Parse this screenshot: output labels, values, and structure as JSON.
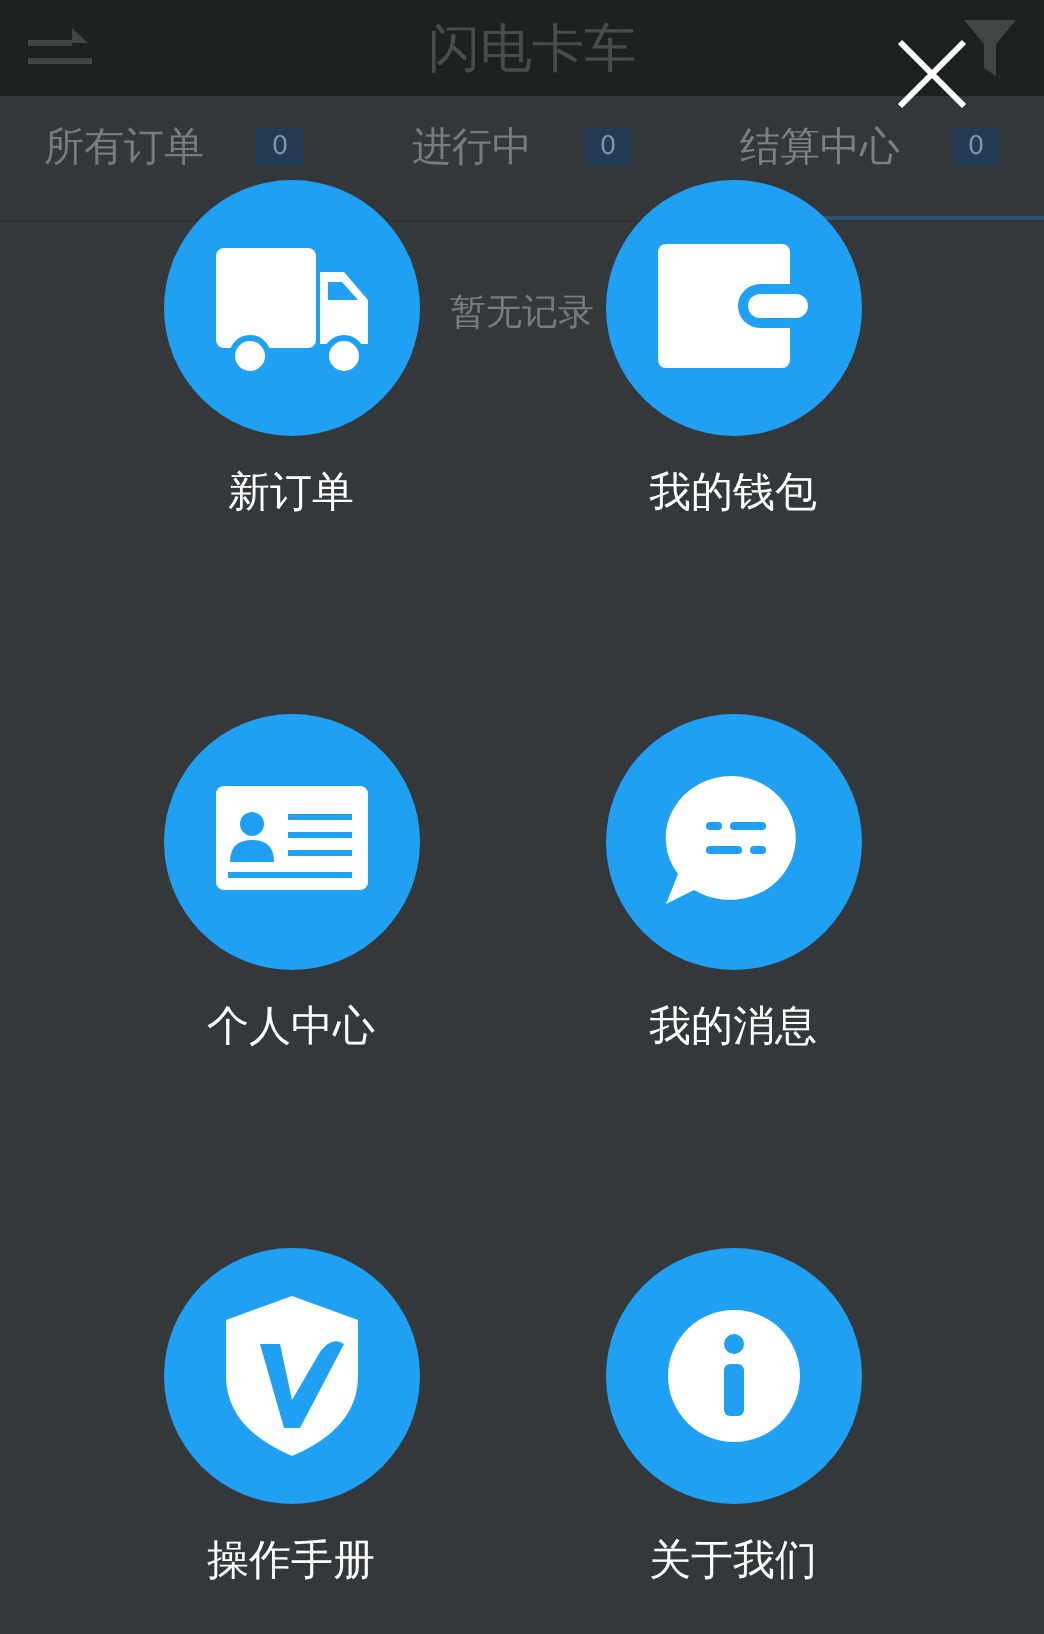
{
  "header": {
    "title": "闪电卡车"
  },
  "tabs": [
    {
      "label": "所有订单",
      "count": "0",
      "selected": false
    },
    {
      "label": "进行中",
      "count": "0",
      "selected": false
    },
    {
      "label": "结算中心",
      "count": "0",
      "selected": true
    }
  ],
  "empty_message": "暂无记录",
  "menu": {
    "items": [
      {
        "label": "新订单",
        "kind": "truck"
      },
      {
        "label": "我的钱包",
        "kind": "wallet"
      },
      {
        "label": "个人中心",
        "kind": "card"
      },
      {
        "label": "我的消息",
        "kind": "chat"
      },
      {
        "label": "操作手册",
        "kind": "shield"
      },
      {
        "label": "关于我们",
        "kind": "info"
      }
    ]
  }
}
